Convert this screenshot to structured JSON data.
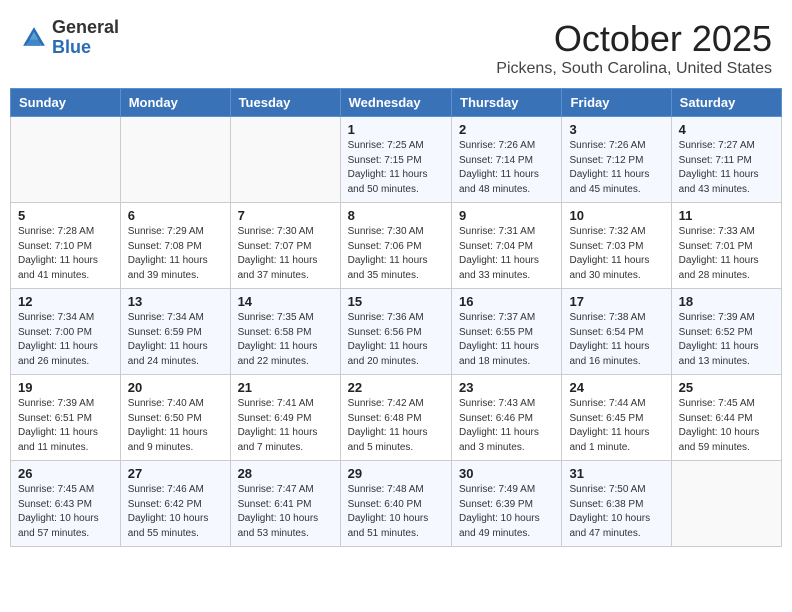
{
  "header": {
    "logo_general": "General",
    "logo_blue": "Blue",
    "month": "October 2025",
    "location": "Pickens, South Carolina, United States"
  },
  "days_of_week": [
    "Sunday",
    "Monday",
    "Tuesday",
    "Wednesday",
    "Thursday",
    "Friday",
    "Saturday"
  ],
  "weeks": [
    [
      {
        "day": "",
        "info": ""
      },
      {
        "day": "",
        "info": ""
      },
      {
        "day": "",
        "info": ""
      },
      {
        "day": "1",
        "info": "Sunrise: 7:25 AM\nSunset: 7:15 PM\nDaylight: 11 hours\nand 50 minutes."
      },
      {
        "day": "2",
        "info": "Sunrise: 7:26 AM\nSunset: 7:14 PM\nDaylight: 11 hours\nand 48 minutes."
      },
      {
        "day": "3",
        "info": "Sunrise: 7:26 AM\nSunset: 7:12 PM\nDaylight: 11 hours\nand 45 minutes."
      },
      {
        "day": "4",
        "info": "Sunrise: 7:27 AM\nSunset: 7:11 PM\nDaylight: 11 hours\nand 43 minutes."
      }
    ],
    [
      {
        "day": "5",
        "info": "Sunrise: 7:28 AM\nSunset: 7:10 PM\nDaylight: 11 hours\nand 41 minutes."
      },
      {
        "day": "6",
        "info": "Sunrise: 7:29 AM\nSunset: 7:08 PM\nDaylight: 11 hours\nand 39 minutes."
      },
      {
        "day": "7",
        "info": "Sunrise: 7:30 AM\nSunset: 7:07 PM\nDaylight: 11 hours\nand 37 minutes."
      },
      {
        "day": "8",
        "info": "Sunrise: 7:30 AM\nSunset: 7:06 PM\nDaylight: 11 hours\nand 35 minutes."
      },
      {
        "day": "9",
        "info": "Sunrise: 7:31 AM\nSunset: 7:04 PM\nDaylight: 11 hours\nand 33 minutes."
      },
      {
        "day": "10",
        "info": "Sunrise: 7:32 AM\nSunset: 7:03 PM\nDaylight: 11 hours\nand 30 minutes."
      },
      {
        "day": "11",
        "info": "Sunrise: 7:33 AM\nSunset: 7:01 PM\nDaylight: 11 hours\nand 28 minutes."
      }
    ],
    [
      {
        "day": "12",
        "info": "Sunrise: 7:34 AM\nSunset: 7:00 PM\nDaylight: 11 hours\nand 26 minutes."
      },
      {
        "day": "13",
        "info": "Sunrise: 7:34 AM\nSunset: 6:59 PM\nDaylight: 11 hours\nand 24 minutes."
      },
      {
        "day": "14",
        "info": "Sunrise: 7:35 AM\nSunset: 6:58 PM\nDaylight: 11 hours\nand 22 minutes."
      },
      {
        "day": "15",
        "info": "Sunrise: 7:36 AM\nSunset: 6:56 PM\nDaylight: 11 hours\nand 20 minutes."
      },
      {
        "day": "16",
        "info": "Sunrise: 7:37 AM\nSunset: 6:55 PM\nDaylight: 11 hours\nand 18 minutes."
      },
      {
        "day": "17",
        "info": "Sunrise: 7:38 AM\nSunset: 6:54 PM\nDaylight: 11 hours\nand 16 minutes."
      },
      {
        "day": "18",
        "info": "Sunrise: 7:39 AM\nSunset: 6:52 PM\nDaylight: 11 hours\nand 13 minutes."
      }
    ],
    [
      {
        "day": "19",
        "info": "Sunrise: 7:39 AM\nSunset: 6:51 PM\nDaylight: 11 hours\nand 11 minutes."
      },
      {
        "day": "20",
        "info": "Sunrise: 7:40 AM\nSunset: 6:50 PM\nDaylight: 11 hours\nand 9 minutes."
      },
      {
        "day": "21",
        "info": "Sunrise: 7:41 AM\nSunset: 6:49 PM\nDaylight: 11 hours\nand 7 minutes."
      },
      {
        "day": "22",
        "info": "Sunrise: 7:42 AM\nSunset: 6:48 PM\nDaylight: 11 hours\nand 5 minutes."
      },
      {
        "day": "23",
        "info": "Sunrise: 7:43 AM\nSunset: 6:46 PM\nDaylight: 11 hours\nand 3 minutes."
      },
      {
        "day": "24",
        "info": "Sunrise: 7:44 AM\nSunset: 6:45 PM\nDaylight: 11 hours\nand 1 minute."
      },
      {
        "day": "25",
        "info": "Sunrise: 7:45 AM\nSunset: 6:44 PM\nDaylight: 10 hours\nand 59 minutes."
      }
    ],
    [
      {
        "day": "26",
        "info": "Sunrise: 7:45 AM\nSunset: 6:43 PM\nDaylight: 10 hours\nand 57 minutes."
      },
      {
        "day": "27",
        "info": "Sunrise: 7:46 AM\nSunset: 6:42 PM\nDaylight: 10 hours\nand 55 minutes."
      },
      {
        "day": "28",
        "info": "Sunrise: 7:47 AM\nSunset: 6:41 PM\nDaylight: 10 hours\nand 53 minutes."
      },
      {
        "day": "29",
        "info": "Sunrise: 7:48 AM\nSunset: 6:40 PM\nDaylight: 10 hours\nand 51 minutes."
      },
      {
        "day": "30",
        "info": "Sunrise: 7:49 AM\nSunset: 6:39 PM\nDaylight: 10 hours\nand 49 minutes."
      },
      {
        "day": "31",
        "info": "Sunrise: 7:50 AM\nSunset: 6:38 PM\nDaylight: 10 hours\nand 47 minutes."
      },
      {
        "day": "",
        "info": ""
      }
    ]
  ]
}
